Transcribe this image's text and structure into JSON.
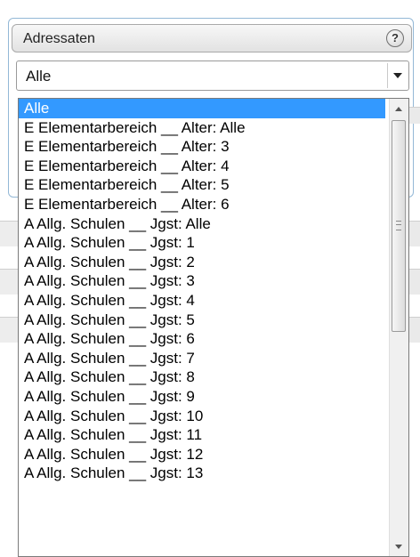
{
  "header": {
    "title": "Adressaten",
    "help_label": "?"
  },
  "select": {
    "value": "Alle"
  },
  "dropdown": {
    "options": [
      "Alle",
      "E Elementarbereich __ Alter: Alle",
      "E Elementarbereich __ Alter: 3",
      "E Elementarbereich __ Alter: 4",
      "E Elementarbereich __ Alter: 5",
      "E Elementarbereich __ Alter: 6",
      "A Allg. Schulen __ Jgst: Alle",
      "A Allg. Schulen __ Jgst: 1",
      "A Allg. Schulen __ Jgst: 2",
      "A Allg. Schulen __ Jgst: 3",
      "A Allg. Schulen __ Jgst: 4",
      "A Allg. Schulen __ Jgst: 5",
      "A Allg. Schulen __ Jgst: 6",
      "A Allg. Schulen __ Jgst: 7",
      "A Allg. Schulen __ Jgst: 8",
      "A Allg. Schulen __ Jgst: 9",
      "A Allg. Schulen __ Jgst: 10",
      "A Allg. Schulen __ Jgst: 11",
      "A Allg. Schulen __ Jgst: 12",
      "A Allg. Schulen __ Jgst: 13"
    ],
    "selected_index": 0
  },
  "colors": {
    "highlight": "#3399ff",
    "frame": "#93b8d6"
  },
  "icons": {
    "help": "help-icon",
    "dropdown_arrow": "chevron-down-icon",
    "scroll_up": "scroll-up-icon",
    "scroll_down": "scroll-down-icon"
  }
}
